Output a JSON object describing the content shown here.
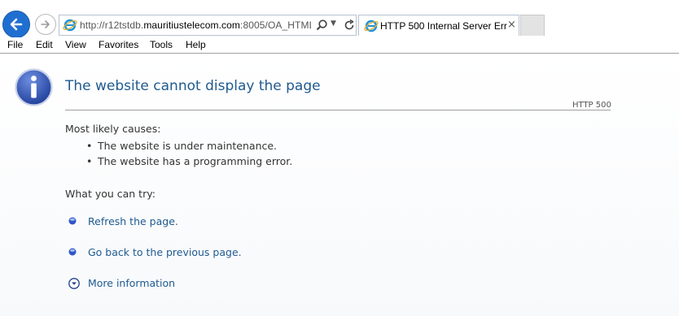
{
  "browser": {
    "address_url_prefix": "http://r12tstdb.",
    "address_url_host": "mauritiustelecom.com",
    "address_url_rest": ":8005/OA_HTML",
    "tab_title": "HTTP 500 Internal Server Err...",
    "tab_close": "×",
    "menu": [
      "File",
      "Edit",
      "View",
      "Favorites",
      "Tools",
      "Help"
    ]
  },
  "page": {
    "title": "The website cannot display the page",
    "http_code": "HTTP 500",
    "causes_label": "Most likely causes:",
    "causes": [
      "The website is under maintenance.",
      "The website has a programming error."
    ],
    "try_label": "What you can try:",
    "actions": [
      "Refresh the page.",
      "Go back to the previous page."
    ],
    "more_info": "More information"
  },
  "colors": {
    "title": "#1f5a8f",
    "link": "#1f5a8f",
    "back_button": "#1f6fd1",
    "info_icon": "#2b4fb0"
  },
  "icons": {
    "back": "back-arrow-icon",
    "forward": "forward-arrow-icon",
    "ie": "internet-explorer-icon",
    "search": "search-icon",
    "refresh": "refresh-icon",
    "info": "info-icon",
    "bullet": "blue-bullet-icon",
    "more": "chevron-down-circle-icon"
  }
}
